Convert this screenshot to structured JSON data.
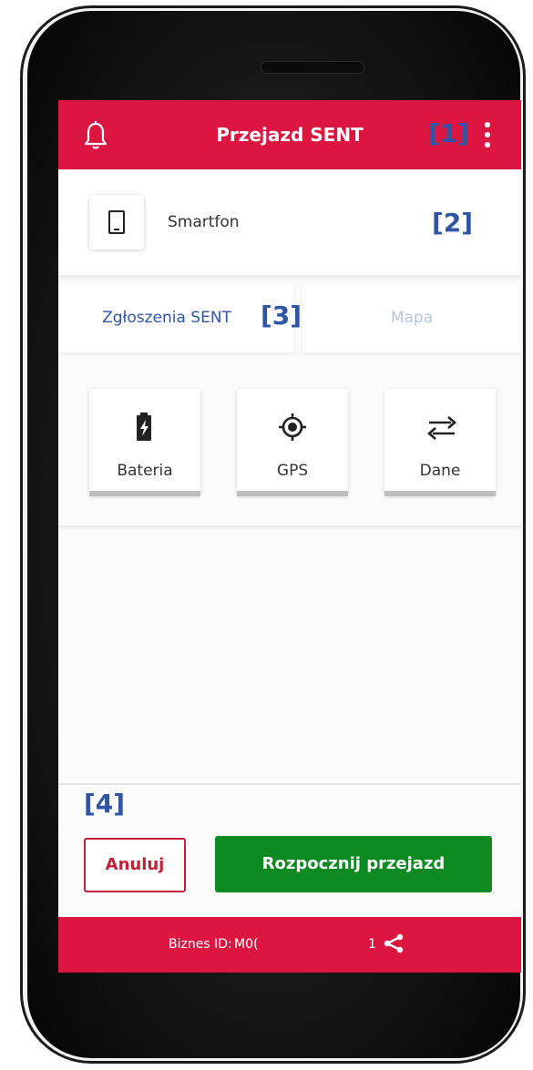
{
  "header": {
    "title": "Przejazd SENT"
  },
  "annotations": {
    "a1": "[1]",
    "a2": "[2]",
    "a3": "[3]",
    "a4": "[4]"
  },
  "device": {
    "label": "Smartfon"
  },
  "tabs": [
    {
      "label": "Zgłoszenia SENT",
      "active": true
    },
    {
      "label": "Mapa",
      "active": false
    }
  ],
  "status_cards": [
    {
      "label": "Bateria",
      "icon": "battery-charging-icon"
    },
    {
      "label": "GPS",
      "icon": "gps-target-icon"
    },
    {
      "label": "Dane",
      "icon": "data-transfer-icon"
    }
  ],
  "actions": {
    "cancel": "Anuluj",
    "start": "Rozpocznij przejazd"
  },
  "footer": {
    "biz_label": "Biznes ID:",
    "biz_id": "M0(",
    "share_count": "1"
  },
  "colors": {
    "brand_red": "#dc1640",
    "primary_green": "#0d8a21",
    "link_blue": "#2f55a4",
    "annotation_blue": "#2f55a4"
  }
}
